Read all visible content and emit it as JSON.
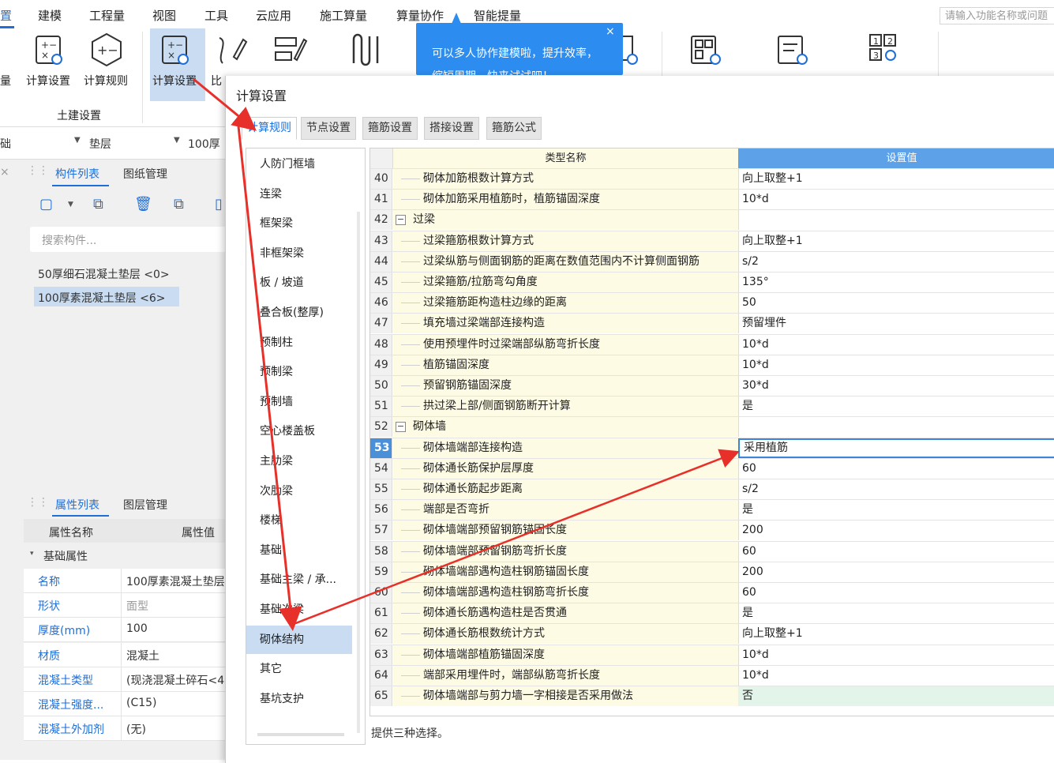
{
  "menu": {
    "items": [
      "置",
      "建模",
      "工程量",
      "视图",
      "工具",
      "云应用",
      "施工算量",
      "算量协作",
      "智能提量"
    ],
    "search_placeholder": "请输入功能名称或问题"
  },
  "ribbon": {
    "btn_calc_settings": "计算设置",
    "btn_calc_rules": "计算规则",
    "btn_calc_settings_2": "计算设置",
    "btn_compare": "比",
    "left_edge_char": "量",
    "group_label": "土建设置"
  },
  "tooltip": {
    "line1": "可以多人协作建模啦，提升效率，",
    "line2": "缩短周期，快来试试吧！",
    "close": "×"
  },
  "left": {
    "floor_left": "础",
    "floor_mid": "垫层",
    "floor_right": "100厚",
    "tab_component_list": "构件列表",
    "tab_drawing_mgmt": "图纸管理",
    "search_placeholder": "搜索构件...",
    "components": [
      "50厚细石混凝土垫层 <0>",
      "100厚素混凝土垫层 <6>"
    ],
    "tab_property_list": "属性列表",
    "tab_layer_mgmt": "图层管理",
    "prop_header_name": "属性名称",
    "prop_header_value": "属性值",
    "prop_group": "基础属性",
    "props": [
      {
        "name": "名称",
        "value": "100厚素混凝土垫层"
      },
      {
        "name": "形状",
        "value": "面型"
      },
      {
        "name": "厚度(mm)",
        "value": "100"
      },
      {
        "name": "材质",
        "value": "混凝土"
      },
      {
        "name": "混凝土类型",
        "value": "(现浇混凝土碎石<4"
      },
      {
        "name": "混凝土强度...",
        "value": "(C15)"
      },
      {
        "name": "混凝土外加剂",
        "value": "(无)"
      }
    ]
  },
  "dialog": {
    "title": "计算设置",
    "tabs": [
      "计算规则",
      "节点设置",
      "箍筋设置",
      "搭接设置",
      "箍筋公式"
    ],
    "categories": [
      "人防门框墙",
      "连梁",
      "框架梁",
      "非框架梁",
      "板 / 坡道",
      "叠合板(整厚)",
      "预制柱",
      "预制梁",
      "预制墙",
      "空心楼盖板",
      "主肋梁",
      "次肋梁",
      "楼梯",
      "基础",
      "基础主梁 / 承...",
      "基础次梁",
      "砌体结构",
      "其它",
      "基坑支护"
    ],
    "selected_category": "砌体结构",
    "col_name": "类型名称",
    "col_value": "设置值",
    "rows": [
      {
        "n": "40",
        "name": "砌体加筋根数计算方式",
        "value": "向上取整+1"
      },
      {
        "n": "41",
        "name": "砌体加筋采用植筋时，植筋锚固深度",
        "value": "10*d"
      },
      {
        "n": "42",
        "name": "过梁",
        "value": "",
        "group": true
      },
      {
        "n": "43",
        "name": "过梁箍筋根数计算方式",
        "value": "向上取整+1"
      },
      {
        "n": "44",
        "name": "过梁纵筋与侧面钢筋的距离在数值范围内不计算侧面钢筋",
        "value": "s/2"
      },
      {
        "n": "45",
        "name": "过梁箍筋/拉筋弯勾角度",
        "value": "135°"
      },
      {
        "n": "46",
        "name": "过梁箍筋距构造柱边缘的距离",
        "value": "50"
      },
      {
        "n": "47",
        "name": "填充墙过梁端部连接构造",
        "value": "预留埋件"
      },
      {
        "n": "48",
        "name": "使用预埋件时过梁端部纵筋弯折长度",
        "value": "10*d"
      },
      {
        "n": "49",
        "name": "植筋锚固深度",
        "value": "10*d"
      },
      {
        "n": "50",
        "name": "预留钢筋锚固深度",
        "value": "30*d"
      },
      {
        "n": "51",
        "name": "拱过梁上部/侧面钢筋断开计算",
        "value": "是"
      },
      {
        "n": "52",
        "name": "砌体墙",
        "value": "",
        "group": true
      },
      {
        "n": "53",
        "name": "砌体墙端部连接构造",
        "value": "采用植筋",
        "selected": true
      },
      {
        "n": "54",
        "name": "砌体通长筋保护层厚度",
        "value": "60"
      },
      {
        "n": "55",
        "name": "砌体通长筋起步距离",
        "value": "s/2"
      },
      {
        "n": "56",
        "name": "端部是否弯折",
        "value": "是"
      },
      {
        "n": "57",
        "name": "砌体墙端部预留钢筋锚固长度",
        "value": "200"
      },
      {
        "n": "58",
        "name": "砌体墙端部预留钢筋弯折长度",
        "value": "60"
      },
      {
        "n": "59",
        "name": "砌体墙端部遇构造柱钢筋锚固长度",
        "value": "200"
      },
      {
        "n": "60",
        "name": "砌体墙端部遇构造柱钢筋弯折长度",
        "value": "60"
      },
      {
        "n": "61",
        "name": "砌体通长筋遇构造柱是否贯通",
        "value": "是"
      },
      {
        "n": "62",
        "name": "砌体通长筋根数统计方式",
        "value": "向上取整+1"
      },
      {
        "n": "63",
        "name": "砌体墙端部植筋锚固深度",
        "value": "10*d"
      },
      {
        "n": "64",
        "name": "端部采用埋件时，端部纵筋弯折长度",
        "value": "10*d"
      },
      {
        "n": "65",
        "name": "砌体墙端部与剪力墙一字相接是否采用做法",
        "value": "否",
        "highlight": true
      }
    ],
    "description": "提供三种选择。"
  },
  "colors": {
    "accent": "#1e6fd9",
    "annotation_arrow": "#e8302a",
    "tooltip_bg": "#2d8cf0",
    "row_name_bg": "#fdfbe4",
    "selected_row_bg": "#4a90d9"
  }
}
